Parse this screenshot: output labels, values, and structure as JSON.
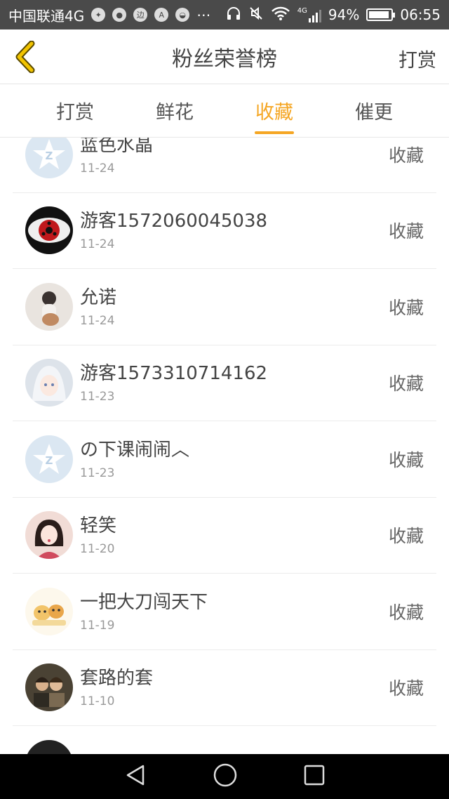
{
  "status_bar": {
    "carrier": "中国联通4G",
    "battery": "94%",
    "time": "06:55",
    "network": "4G"
  },
  "header": {
    "title": "粉丝荣誉榜",
    "action": "打赏"
  },
  "tabs": [
    {
      "label": "打赏",
      "active": false
    },
    {
      "label": "鲜花",
      "active": false
    },
    {
      "label": "收藏",
      "active": true
    },
    {
      "label": "催更",
      "active": false
    }
  ],
  "fans": [
    {
      "name": "蓝色水晶",
      "date": "11-24",
      "action": "收藏",
      "avatar": "default-star-avatar"
    },
    {
      "name": "游客1572060045038",
      "date": "11-24",
      "action": "收藏",
      "avatar": "red-eye-avatar"
    },
    {
      "name": "允诺",
      "date": "11-24",
      "action": "收藏",
      "avatar": "girl-photo-avatar"
    },
    {
      "name": "游客1573310714162",
      "date": "11-23",
      "action": "收藏",
      "avatar": "anime-avatar"
    },
    {
      "name": "の下课闹闹︿",
      "date": "11-23",
      "action": "收藏",
      "avatar": "default-star-avatar"
    },
    {
      "name": "轻笑",
      "date": "11-20",
      "action": "收藏",
      "avatar": "illustrated-girl-avatar"
    },
    {
      "name": "一把大刀闯天下",
      "date": "11-19",
      "action": "收藏",
      "avatar": "cartoon-animals-avatar"
    },
    {
      "name": "套路的套",
      "date": "11-10",
      "action": "收藏",
      "avatar": "couple-photo-avatar"
    }
  ],
  "colors": {
    "accent": "#f5a623",
    "status_bar": "#4a4a4a"
  }
}
